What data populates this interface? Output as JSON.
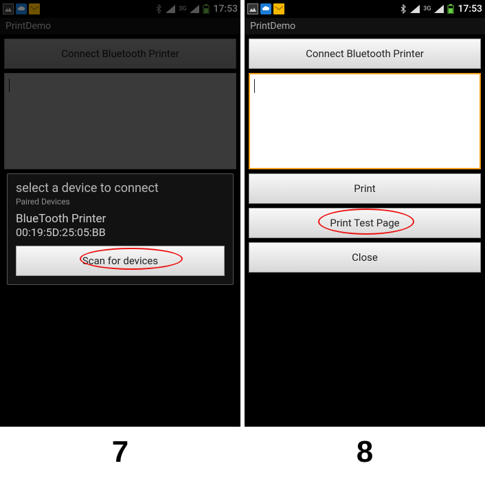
{
  "statusbar": {
    "time": "17:53",
    "network_label": "3G"
  },
  "app_title": "PrintDemo",
  "screen7": {
    "connect_btn": "Connect Bluetooth Printer",
    "modal": {
      "title": "select a device to connect",
      "subtitle": "Paired Devices",
      "device_name": "BlueTooth Printer",
      "device_mac": "00:19:5D:25:05:BB",
      "scan_btn": "Scan for devices"
    },
    "caption": "7"
  },
  "screen8": {
    "connect_btn": "Connect Bluetooth Printer",
    "print_btn": "Print",
    "test_btn": "Print Test Page",
    "close_btn": "Close",
    "caption": "8"
  }
}
